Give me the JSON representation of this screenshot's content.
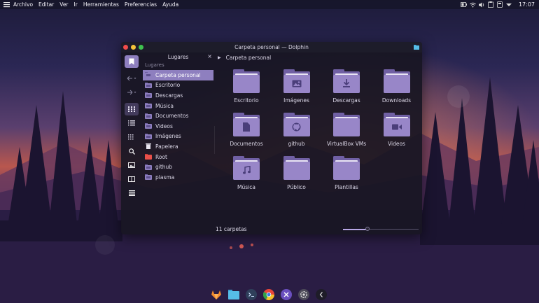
{
  "menubar": {
    "items": [
      "Archivo",
      "Editar",
      "Ver",
      "Ir",
      "Herramientas",
      "Preferencias",
      "Ayuda"
    ],
    "clock": "17:07"
  },
  "window": {
    "title": "Carpeta personal — Dolphin",
    "breadcrumb": "Carpeta personal",
    "status": "11 carpetas",
    "zoom_level": 0.32
  },
  "places": {
    "header": "Lugares",
    "close": "×",
    "group": "Lugares",
    "items": [
      {
        "label": "Carpeta personal",
        "icon": "home-folder-icon",
        "color": "#6e5fa0"
      },
      {
        "label": "Escritorio",
        "icon": "desktop-folder-icon",
        "color": "#8e7fbf"
      },
      {
        "label": "Descargas",
        "icon": "download-folder-icon",
        "color": "#8e7fbf"
      },
      {
        "label": "Música",
        "icon": "music-folder-icon",
        "color": "#8e7fbf"
      },
      {
        "label": "Documentos",
        "icon": "documents-folder-icon",
        "color": "#8e7fbf"
      },
      {
        "label": "Videos",
        "icon": "videos-folder-icon",
        "color": "#8e7fbf"
      },
      {
        "label": "Imágenes",
        "icon": "pictures-folder-icon",
        "color": "#8e7fbf"
      },
      {
        "label": "Papelera",
        "icon": "trash-icon",
        "color": "#e0dde8"
      },
      {
        "label": "Root",
        "icon": "root-folder-icon",
        "color": "#e8504a"
      },
      {
        "label": "github",
        "icon": "github-folder-icon",
        "color": "#8e7fbf"
      },
      {
        "label": "plasma",
        "icon": "plasma-folder-icon",
        "color": "#8e7fbf"
      }
    ]
  },
  "folders": [
    {
      "label": "Escritorio",
      "glyph": "none"
    },
    {
      "label": "Imágenes",
      "glyph": "image-icon"
    },
    {
      "label": "Descargas",
      "glyph": "download-icon"
    },
    {
      "label": "Downloads",
      "glyph": "none"
    },
    {
      "label": "Documentos",
      "glyph": "document-icon"
    },
    {
      "label": "github",
      "glyph": "github-icon"
    },
    {
      "label": "VirtualBox VMs",
      "glyph": "none"
    },
    {
      "label": "Videos",
      "glyph": "video-camera-icon"
    },
    {
      "label": "Música",
      "glyph": "music-note-icon"
    },
    {
      "label": "Público",
      "glyph": "none"
    },
    {
      "label": "Plantillas",
      "glyph": "none"
    }
  ],
  "dock": [
    "gitlab-icon",
    "files-icon",
    "terminal-icon",
    "chrome-icon",
    "visual-studio-icon",
    "settings-icon",
    "apps-icon"
  ],
  "colors": {
    "accent": "#8e7fbf",
    "folder_front": "#9886c8",
    "folder_back": "#7060a4"
  }
}
